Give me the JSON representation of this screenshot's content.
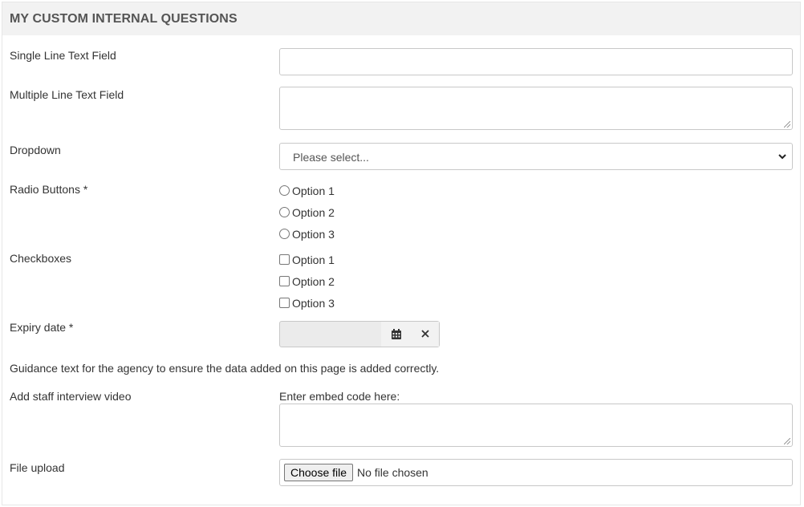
{
  "section": {
    "title": "MY CUSTOM INTERNAL QUESTIONS"
  },
  "fields": {
    "single_line": {
      "label": "Single Line Text Field",
      "value": ""
    },
    "multi_line": {
      "label": "Multiple Line Text Field",
      "value": ""
    },
    "dropdown": {
      "label": "Dropdown",
      "selected": "Please select..."
    },
    "radio": {
      "label": "Radio Buttons *",
      "options": [
        "Option 1",
        "Option 2",
        "Option 3"
      ]
    },
    "checkboxes": {
      "label": "Checkboxes",
      "options": [
        "Option 1",
        "Option 2",
        "Option 3"
      ]
    },
    "expiry": {
      "label": "Expiry date *",
      "value": ""
    },
    "video": {
      "label": "Add staff interview video",
      "embed_label": "Enter embed code here:"
    },
    "file": {
      "label": "File upload",
      "button": "Choose file",
      "status": "No file chosen"
    }
  },
  "guidance": "Guidance text for the agency to ensure the data added on this page is added correctly.",
  "icons": {
    "calendar": "calendar-icon",
    "clear": "close-icon",
    "dropdown": "chevron-down-icon"
  }
}
